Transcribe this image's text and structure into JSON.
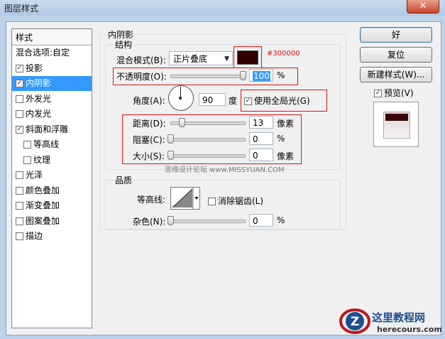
{
  "window": {
    "title": "图层样式",
    "close_glyph": "✕"
  },
  "styles_panel": {
    "header": "样式",
    "items": [
      {
        "label": "混合选项:自定",
        "check": "none",
        "selected": false
      },
      {
        "label": "投影",
        "check": "checked",
        "selected": false
      },
      {
        "label": "内阴影",
        "check": "checked",
        "selected": true
      },
      {
        "label": "外发光",
        "check": "unchecked",
        "selected": false
      },
      {
        "label": "内发光",
        "check": "unchecked",
        "selected": false
      },
      {
        "label": "斜面和浮雕",
        "check": "checked",
        "selected": false
      },
      {
        "label": "等高线",
        "check": "unchecked",
        "selected": false
      },
      {
        "label": "纹理",
        "check": "unchecked",
        "selected": false
      },
      {
        "label": "光泽",
        "check": "unchecked",
        "selected": false
      },
      {
        "label": "颜色叠加",
        "check": "unchecked",
        "selected": false
      },
      {
        "label": "渐变叠加",
        "check": "unchecked",
        "selected": false
      },
      {
        "label": "图案叠加",
        "check": "unchecked",
        "selected": false
      },
      {
        "label": "描边",
        "check": "unchecked",
        "selected": false
      }
    ]
  },
  "inner_shadow": {
    "group_title": "内阴影",
    "structure_title": "结构",
    "blend_mode_label": "混合模式(B):",
    "blend_mode_value": "正片叠底",
    "color_swatch": "#300000",
    "color_annotation": "#300000",
    "opacity_label": "不透明度(O):",
    "opacity_value": "100",
    "opacity_unit": "%",
    "angle_label": "角度(A):",
    "angle_value": "90",
    "angle_unit": "度",
    "global_light_label": "使用全局光(G)",
    "distance_label": "距离(D):",
    "distance_value": "13",
    "distance_unit": "像素",
    "choke_label": "阻塞(C):",
    "choke_value": "0",
    "choke_unit": "%",
    "size_label": "大小(S):",
    "size_value": "0",
    "size_unit": "像素",
    "watermark": "思缘设计论坛  www.MISSYUAN.COM",
    "quality_title": "品质",
    "contour_label": "等高线:",
    "anti_alias_label": "消除锯齿(L)",
    "noise_label": "杂色(N):",
    "noise_value": "0",
    "noise_unit": "%"
  },
  "side_buttons": {
    "ok": "好",
    "reset": "复位",
    "new_style": "新建样式(W)...",
    "preview_label": "预览(V)"
  },
  "logo": {
    "title": "这里教程网",
    "url": "herecours.com"
  },
  "colors": {
    "swatch": "#300000",
    "selection": "#3399ff",
    "annotation_red": "#e01010"
  }
}
